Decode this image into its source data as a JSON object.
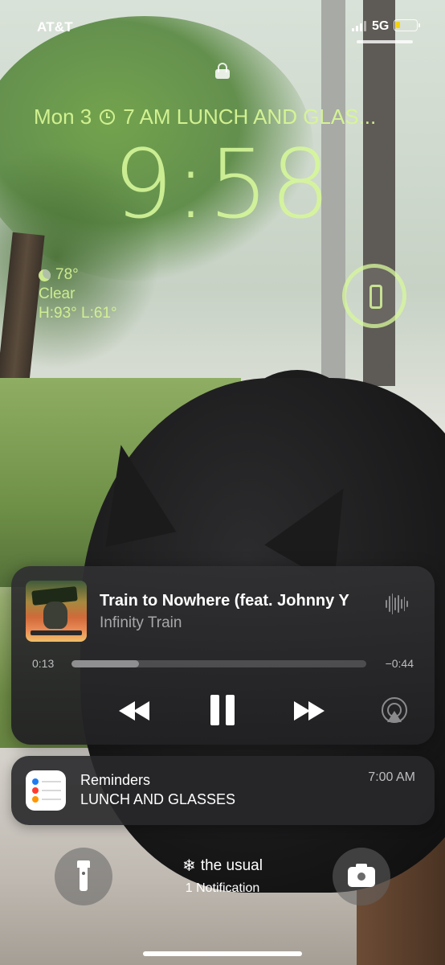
{
  "status_bar": {
    "carrier": "AT&T",
    "network": "5G",
    "battery_level": 0.2,
    "battery_color": "#f5d30a"
  },
  "lock": {
    "icon": "lock-icon"
  },
  "date_line": {
    "date": "Mon 3",
    "reminder": "7 AM LUNCH AND GLAS...",
    "icon": "clock-icon"
  },
  "clock": {
    "time": "9:58",
    "accent_color": "#d6f79a"
  },
  "weather": {
    "temp": "78°",
    "condition": "Clear",
    "high_low": "H:93° L:61°",
    "icon": "moon-icon"
  },
  "widget": {
    "icon": "phone-icon"
  },
  "now_playing": {
    "title": "Train to Nowhere (feat. Johnny Y",
    "artist": "Infinity Train",
    "elapsed": "0:13",
    "remaining": "−0:44",
    "progress": 0.23,
    "icons": [
      "waveform-icon",
      "rewind-icon",
      "pause-icon",
      "fast-forward-icon",
      "airplay-icon"
    ]
  },
  "notification": {
    "app": "Reminders",
    "body": "LUNCH AND GLASSES",
    "time": "7:00 AM",
    "icon": "reminders-app-icon"
  },
  "bottom": {
    "focus_icon": "snowflake-icon",
    "focus_glyph": "❄",
    "focus_label": "the usual",
    "notification_count": "1 Notification",
    "left_button": "flashlight-icon",
    "right_button": "camera-icon"
  }
}
